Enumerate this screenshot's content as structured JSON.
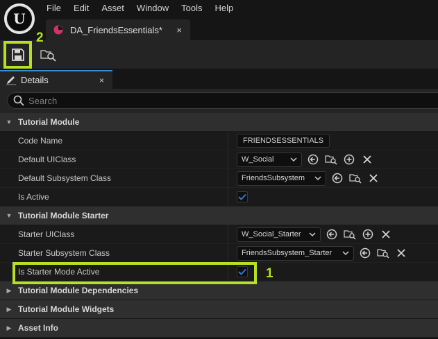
{
  "app": {
    "logo_letter": "U"
  },
  "menu": [
    "File",
    "Edit",
    "Asset",
    "Window",
    "Tools",
    "Help"
  ],
  "document_tab": {
    "label": "DA_FriendsEssentials*",
    "close": "×"
  },
  "callouts": {
    "save_step": "2",
    "checkbox_step": "1",
    "highlight_color": "#b8e023"
  },
  "details": {
    "tab_label": "Details",
    "tab_close": "×",
    "search_placeholder": "Search"
  },
  "sections": {
    "tutorial_module": {
      "label": "Tutorial Module",
      "code_name": {
        "label": "Code Name",
        "value": "FRIENDSESSENTIALS"
      },
      "default_uiclass": {
        "label": "Default UIClass",
        "value": "W_Social"
      },
      "default_subsystem_class": {
        "label": "Default Subsystem Class",
        "value": "FriendsSubsystem"
      },
      "is_active": {
        "label": "Is Active",
        "checked": true
      }
    },
    "tutorial_module_starter": {
      "label": "Tutorial Module Starter",
      "starter_uiclass": {
        "label": "Starter UIClass",
        "value": "W_Social_Starter"
      },
      "starter_subsystem_class": {
        "label": "Starter Subsystem Class",
        "value": "FriendsSubsystem_Starter"
      },
      "is_starter_mode_active": {
        "label": "Is Starter Mode Active",
        "checked": true
      }
    },
    "tutorial_module_dependencies": {
      "label": "Tutorial Module Dependencies"
    },
    "tutorial_module_widgets": {
      "label": "Tutorial Module Widgets"
    },
    "asset_info": {
      "label": "Asset Info"
    }
  },
  "colors": {
    "accent": "#3d8cd6",
    "checkbox": "#2a78d6",
    "tab_asset_icon": "#d6306a"
  }
}
